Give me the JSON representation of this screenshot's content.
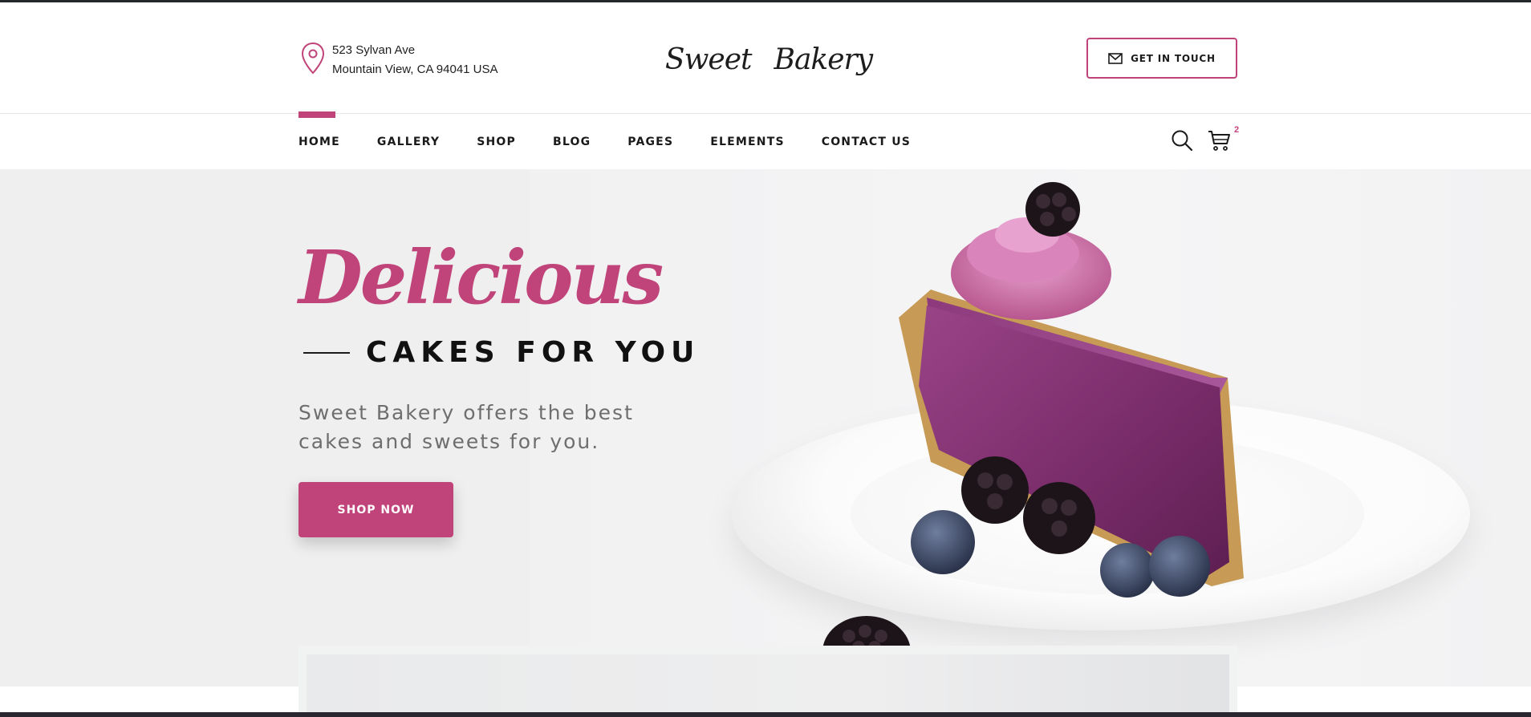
{
  "header": {
    "address_line1": "523 Sylvan Ave",
    "address_line2": "Mountain View, CA 94041 USA",
    "logo_left": "Sweet",
    "logo_right": "Bakery",
    "cta_label": "GET IN TOUCH"
  },
  "nav": {
    "items": [
      {
        "label": "HOME",
        "active": true
      },
      {
        "label": "GALLERY"
      },
      {
        "label": "SHOP"
      },
      {
        "label": "BLOG"
      },
      {
        "label": "PAGES"
      },
      {
        "label": "ELEMENTS"
      },
      {
        "label": "CONTACT US"
      }
    ],
    "cart_count": "2"
  },
  "hero": {
    "headline": "Delicious",
    "subheadline": "CAKES FOR YOU",
    "description": "Sweet Bakery offers the best cakes and sweets for you.",
    "button_label": "SHOP NOW"
  },
  "colors": {
    "accent": "#c0447a",
    "text_dark": "#1a1a1a",
    "text_muted": "#6e6e6e",
    "hero_bg": "#efefef"
  },
  "icons": {
    "location": "map-pin-icon",
    "mail": "mail-icon",
    "search": "search-icon",
    "cart": "cart-icon",
    "logo": "cupcake-icon"
  }
}
